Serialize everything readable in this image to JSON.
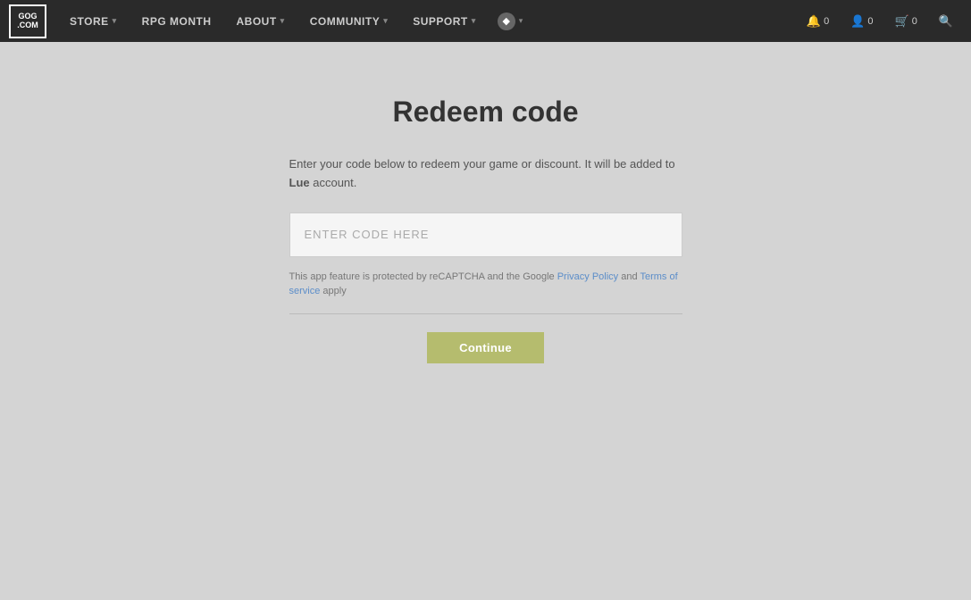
{
  "navbar": {
    "logo_top": "GOG",
    "logo_bottom": "COM",
    "nav_items": [
      {
        "id": "store",
        "label": "STORE",
        "has_dropdown": true
      },
      {
        "id": "rpg-month",
        "label": "RPG MONTH",
        "has_dropdown": false
      },
      {
        "id": "about",
        "label": "ABOUT",
        "has_dropdown": true
      },
      {
        "id": "community",
        "label": "COMMUNITY",
        "has_dropdown": true
      },
      {
        "id": "support",
        "label": "SUPPORT",
        "has_dropdown": true
      }
    ],
    "notification_count": "0",
    "user_count": "0",
    "cart_count": "0"
  },
  "page": {
    "title": "Redeem code",
    "description_part1": "Enter your code below to redeem your game or discount. It will be added to ",
    "description_username": "Lue",
    "description_part2": " account.",
    "code_input_placeholder": "ENTER CODE HERE",
    "recaptcha_text_before": "This app feature is protected by reCAPTCHA and the Google ",
    "privacy_policy_label": "Privacy Policy",
    "recaptcha_and": " and ",
    "terms_label": "Terms of service",
    "recaptcha_after": " apply",
    "continue_button": "Continue"
  }
}
